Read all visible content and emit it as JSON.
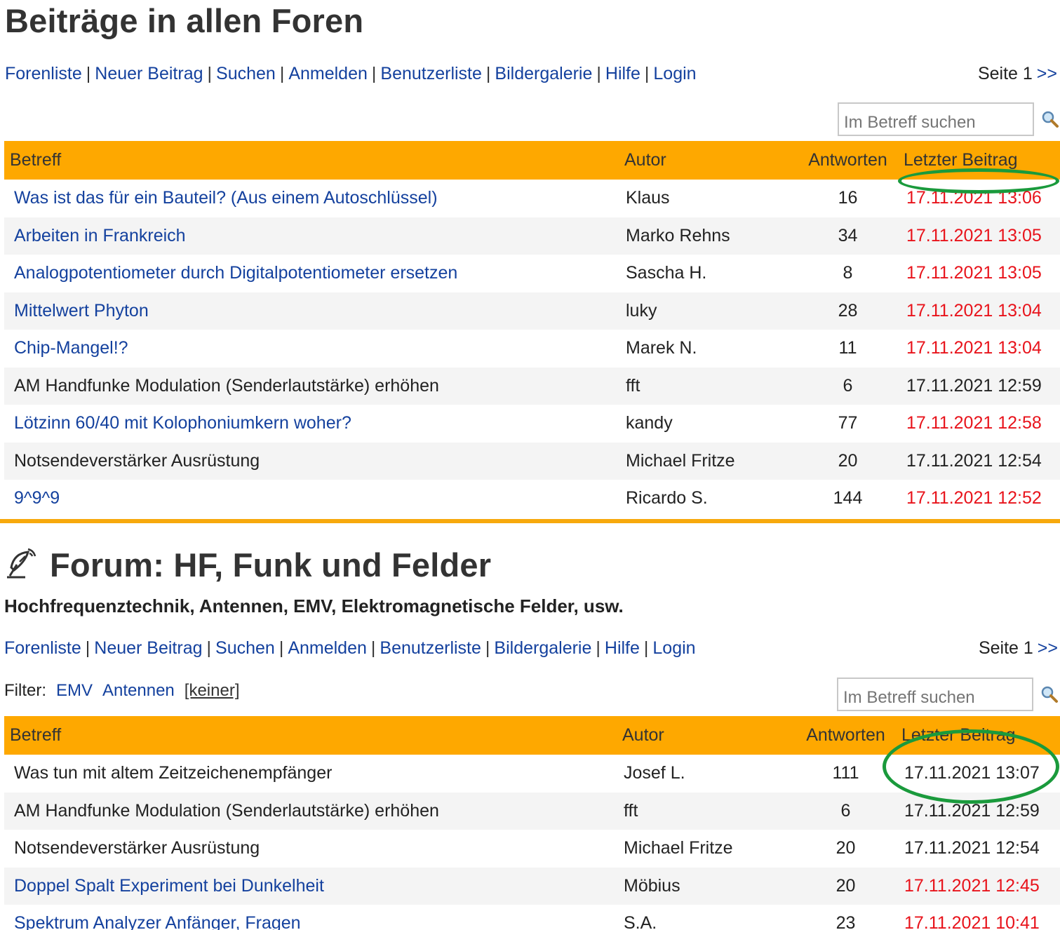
{
  "panel1": {
    "title": "Beiträge in allen Foren",
    "nav": [
      "Forenliste",
      "Neuer Beitrag",
      "Suchen",
      "Anmelden",
      "Benutzerliste",
      "Bildergalerie",
      "Hilfe",
      "Login"
    ],
    "pager": {
      "label": "Seite 1",
      "next": ">>"
    },
    "search": {
      "placeholder": "Im Betreff suchen",
      "icon": "magnifier-icon"
    },
    "columns": {
      "subject": "Betreff",
      "author": "Autor",
      "replies": "Antworten",
      "last": "Letzter Beitrag"
    },
    "rows": [
      {
        "subject": "Was ist das für ein Bauteil? (Aus einem Autoschlüssel)",
        "author": "Klaus",
        "replies": "16",
        "last": "17.11.2021 13:06",
        "unread": true
      },
      {
        "subject": "Arbeiten in Frankreich",
        "author": "Marko Rehns",
        "replies": "34",
        "last": "17.11.2021 13:05",
        "unread": true
      },
      {
        "subject": "Analogpotentiometer durch Digitalpotentiometer ersetzen",
        "author": "Sascha H.",
        "replies": "8",
        "last": "17.11.2021 13:05",
        "unread": true
      },
      {
        "subject": "Mittelwert Phyton",
        "author": "luky",
        "replies": "28",
        "last": "17.11.2021 13:04",
        "unread": true
      },
      {
        "subject": "Chip-Mangel!?",
        "author": "Marek N.",
        "replies": "11",
        "last": "17.11.2021 13:04",
        "unread": true
      },
      {
        "subject": "AM Handfunke Modulation (Senderlautstärke) erhöhen",
        "author": "fft",
        "replies": "6",
        "last": "17.11.2021 12:59",
        "unread": false
      },
      {
        "subject": "Lötzinn 60/40 mit Kolophoniumkern woher?",
        "author": "kandy",
        "replies": "77",
        "last": "17.11.2021 12:58",
        "unread": true
      },
      {
        "subject": "Notsendeverstärker Ausrüstung",
        "author": "Michael Fritze",
        "replies": "20",
        "last": "17.11.2021 12:54",
        "unread": false
      },
      {
        "subject": "9^9^9",
        "author": "Ricardo S.",
        "replies": "144",
        "last": "17.11.2021 12:52",
        "unread": true
      }
    ]
  },
  "panel2": {
    "title": "Forum: HF, Funk und Felder",
    "subtitle": "Hochfrequenztechnik, Antennen, EMV, Elektromagnetische Felder, usw.",
    "nav": [
      "Forenliste",
      "Neuer Beitrag",
      "Suchen",
      "Anmelden",
      "Benutzerliste",
      "Bildergalerie",
      "Hilfe",
      "Login"
    ],
    "pager": {
      "label": "Seite 1",
      "next": ">>"
    },
    "filter": {
      "label": "Filter:",
      "options": [
        "EMV",
        "Antennen",
        "[keiner]"
      ]
    },
    "search": {
      "placeholder": "Im Betreff suchen",
      "icon": "magnifier-icon"
    },
    "columns": {
      "subject": "Betreff",
      "author": "Autor",
      "replies": "Antworten",
      "last": "Letzter Beitrag"
    },
    "rows": [
      {
        "subject": "Was tun mit altem Zeitzeichenempfänger",
        "author": "Josef L.",
        "replies": "111",
        "last": "17.11.2021 13:07",
        "unread": false
      },
      {
        "subject": "AM Handfunke Modulation (Senderlautstärke) erhöhen",
        "author": "fft",
        "replies": "6",
        "last": "17.11.2021 12:59",
        "unread": false
      },
      {
        "subject": "Notsendeverstärker Ausrüstung",
        "author": "Michael Fritze",
        "replies": "20",
        "last": "17.11.2021 12:54",
        "unread": false
      },
      {
        "subject": "Doppel Spalt Experiment bei Dunkelheit",
        "author": "Möbius",
        "replies": "20",
        "last": "17.11.2021 12:45",
        "unread": true
      },
      {
        "subject": "Spektrum Analyzer Anfänger, Fragen",
        "author": "S.A.",
        "replies": "23",
        "last": "17.11.2021 10:41",
        "unread": true
      }
    ]
  },
  "colors": {
    "header": "#fea800",
    "link": "#14419e",
    "new_date": "#e8131b",
    "annotation": "#1a9a3c"
  }
}
